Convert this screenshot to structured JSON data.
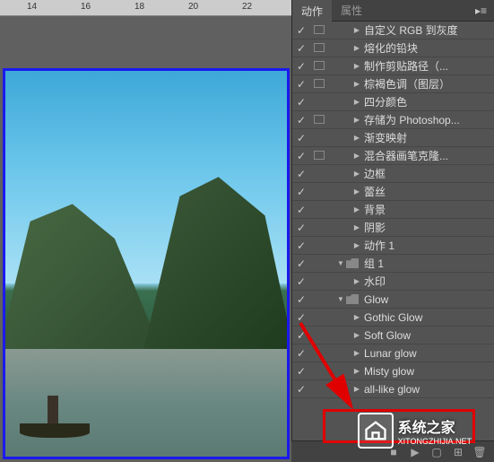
{
  "ruler": {
    "ticks": [
      "14",
      "16",
      "18",
      "20",
      "22"
    ]
  },
  "tabs": {
    "active": "动作",
    "inactive": "属性"
  },
  "actions": [
    {
      "check": true,
      "mode": true,
      "indent": 1,
      "expand": true,
      "folder": false,
      "label": "自定义 RGB 到灰度"
    },
    {
      "check": true,
      "mode": true,
      "indent": 1,
      "expand": true,
      "folder": false,
      "label": "熔化的铅块"
    },
    {
      "check": true,
      "mode": true,
      "indent": 1,
      "expand": true,
      "folder": false,
      "label": "制作剪贴路径（..."
    },
    {
      "check": true,
      "mode": true,
      "indent": 1,
      "expand": true,
      "folder": false,
      "label": "棕褐色调（图层）"
    },
    {
      "check": true,
      "mode": false,
      "indent": 1,
      "expand": true,
      "folder": false,
      "label": "四分颜色"
    },
    {
      "check": true,
      "mode": true,
      "indent": 1,
      "expand": true,
      "folder": false,
      "label": "存储为 Photoshop..."
    },
    {
      "check": true,
      "mode": false,
      "indent": 1,
      "expand": true,
      "folder": false,
      "label": "渐变映射"
    },
    {
      "check": true,
      "mode": true,
      "indent": 1,
      "expand": true,
      "folder": false,
      "label": "混合器画笔克隆..."
    },
    {
      "check": true,
      "mode": false,
      "indent": 1,
      "expand": true,
      "folder": false,
      "label": "边框"
    },
    {
      "check": true,
      "mode": false,
      "indent": 1,
      "expand": true,
      "folder": false,
      "label": "蕾丝"
    },
    {
      "check": true,
      "mode": false,
      "indent": 1,
      "expand": true,
      "folder": false,
      "label": "背景"
    },
    {
      "check": true,
      "mode": false,
      "indent": 1,
      "expand": true,
      "folder": false,
      "label": "阴影"
    },
    {
      "check": true,
      "mode": false,
      "indent": 1,
      "expand": true,
      "folder": false,
      "label": "动作 1"
    },
    {
      "check": true,
      "mode": false,
      "indent": 0,
      "expand": "down",
      "folder": true,
      "label": "组 1"
    },
    {
      "check": true,
      "mode": false,
      "indent": 1,
      "expand": true,
      "folder": false,
      "label": "水印"
    },
    {
      "check": true,
      "mode": false,
      "indent": 0,
      "expand": "down",
      "folder": true,
      "label": "Glow"
    },
    {
      "check": true,
      "mode": false,
      "indent": 1,
      "expand": true,
      "folder": false,
      "label": "Gothic Glow"
    },
    {
      "check": true,
      "mode": false,
      "indent": 1,
      "expand": true,
      "folder": false,
      "label": "Soft Glow"
    },
    {
      "check": true,
      "mode": false,
      "indent": 1,
      "expand": true,
      "folder": false,
      "label": "Lunar glow"
    },
    {
      "check": true,
      "mode": false,
      "indent": 1,
      "expand": true,
      "folder": false,
      "label": "Misty glow"
    },
    {
      "check": true,
      "mode": false,
      "indent": 1,
      "expand": true,
      "folder": false,
      "label": "all-like glow"
    }
  ],
  "watermark": {
    "main": "系统之家",
    "sub": "XITONGZHIJIA.NET"
  },
  "colors": {
    "highlight": "#e00000",
    "arrow": "#e00000"
  }
}
